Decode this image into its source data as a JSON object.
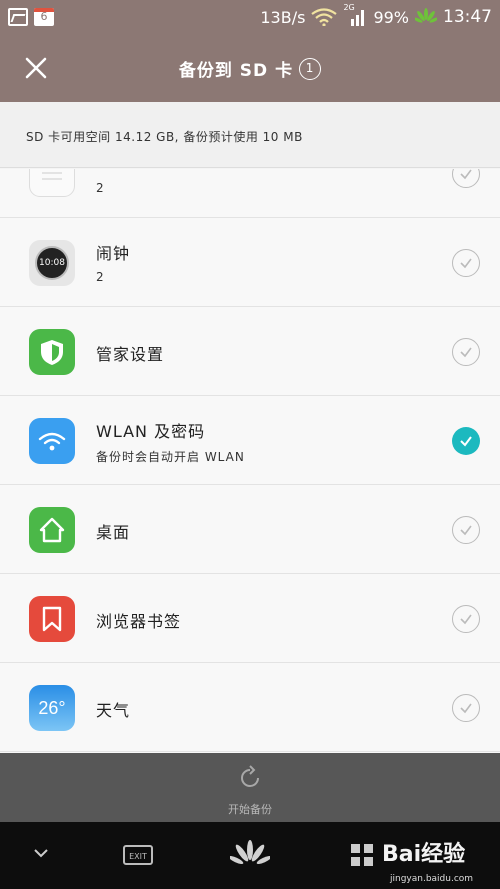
{
  "status_bar": {
    "calendar_day": "6",
    "net_speed": "13B/s",
    "network_type": "2G",
    "battery": "99%",
    "time": "13:47"
  },
  "header": {
    "title": "备份到 SD 卡",
    "badge": "1"
  },
  "info": {
    "text": "SD 卡可用空间 14.12 GB, 备份预计使用 10 MB"
  },
  "items": [
    {
      "name": "",
      "sub": "2",
      "icon": "notes-icon",
      "checked": false
    },
    {
      "name": "闹钟",
      "sub": "2",
      "icon": "clock-icon",
      "icon_text": "10:08",
      "checked": false
    },
    {
      "name": "管家设置",
      "sub": "",
      "icon": "phone-manager-icon",
      "checked": false
    },
    {
      "name": "WLAN 及密码",
      "sub": "备份时会自动开启 WLAN",
      "icon": "wifi-icon",
      "checked": true
    },
    {
      "name": "桌面",
      "sub": "",
      "icon": "home-icon",
      "checked": false
    },
    {
      "name": "浏览器书签",
      "sub": "",
      "icon": "bookmark-icon",
      "checked": false
    },
    {
      "name": "天气",
      "sub": "",
      "icon": "weather-icon",
      "icon_text": "26°",
      "checked": false
    }
  ],
  "bottom": {
    "start_label": "开始备份"
  },
  "nav": {
    "exit_label": "EXIT"
  },
  "watermark": {
    "brand": "Bai经验",
    "url": "jingyan.baidu.com"
  },
  "colors": {
    "header_bg": "#8c7874",
    "accent_check": "#1cb9bf",
    "bottom_bar": "#575757"
  }
}
